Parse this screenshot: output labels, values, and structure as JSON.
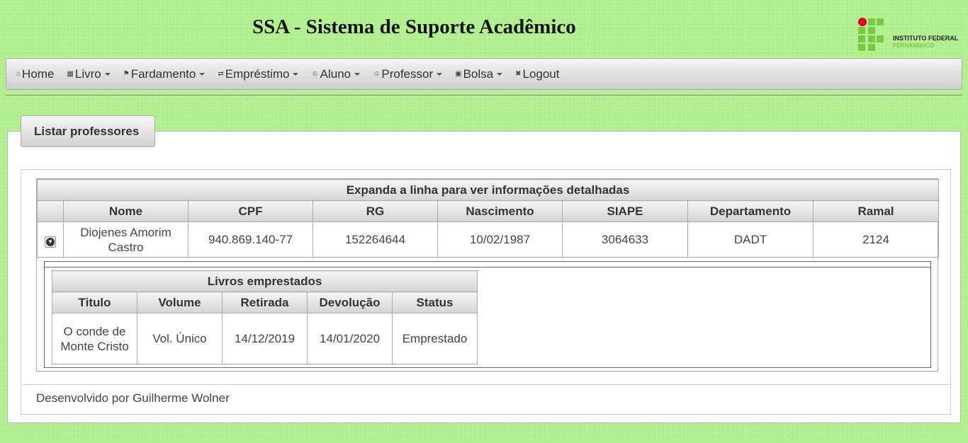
{
  "header": {
    "title": "SSA - Sistema de Suporte Acadêmico",
    "logo_line1": "INSTITUTO FEDERAL",
    "logo_line2": "PERNAMBUCO"
  },
  "nav": {
    "items": [
      {
        "label": "Home",
        "icon": "home-icon",
        "dropdown": false
      },
      {
        "label": "Livro",
        "icon": "book-icon",
        "dropdown": true
      },
      {
        "label": "Fardamento",
        "icon": "flag-icon",
        "dropdown": true
      },
      {
        "label": "Empréstimo",
        "icon": "exchange-icon",
        "dropdown": true
      },
      {
        "label": "Aluno",
        "icon": "user-icon",
        "dropdown": true
      },
      {
        "label": "Professor",
        "icon": "user-icon",
        "dropdown": true
      },
      {
        "label": "Bolsa",
        "icon": "bag-icon",
        "dropdown": true
      },
      {
        "label": "Logout",
        "icon": "close-icon",
        "dropdown": false
      }
    ]
  },
  "page": {
    "tab_label": "Listar professores",
    "table_caption": "Expanda a linha para ver informações detalhadas",
    "columns": [
      "Nome",
      "CPF",
      "RG",
      "Nascimento",
      "SIAPE",
      "Departamento",
      "Ramal"
    ],
    "rows": [
      {
        "nome": "Diojenes Amorim Castro",
        "cpf": "940.869.140-77",
        "rg": "152264644",
        "nascimento": "10/02/1987",
        "siape": "3064633",
        "departamento": "DADT",
        "ramal": "2124"
      }
    ],
    "sub": {
      "caption": "Livros emprestados",
      "columns": [
        "Titulo",
        "Volume",
        "Retirada",
        "Devolução",
        "Status"
      ],
      "rows": [
        {
          "titulo": "O conde de Monte Cristo",
          "volume": "Vol. Único",
          "retirada": "14/12/2019",
          "devolucao": "14/01/2020",
          "status": "Emprestado"
        }
      ]
    }
  },
  "footer": {
    "text": "Desenvolvido por Guilherme Wolner"
  },
  "colors": {
    "background": "#b2f08f",
    "logo_green": "#7ac943",
    "logo_red": "#e3001b"
  }
}
